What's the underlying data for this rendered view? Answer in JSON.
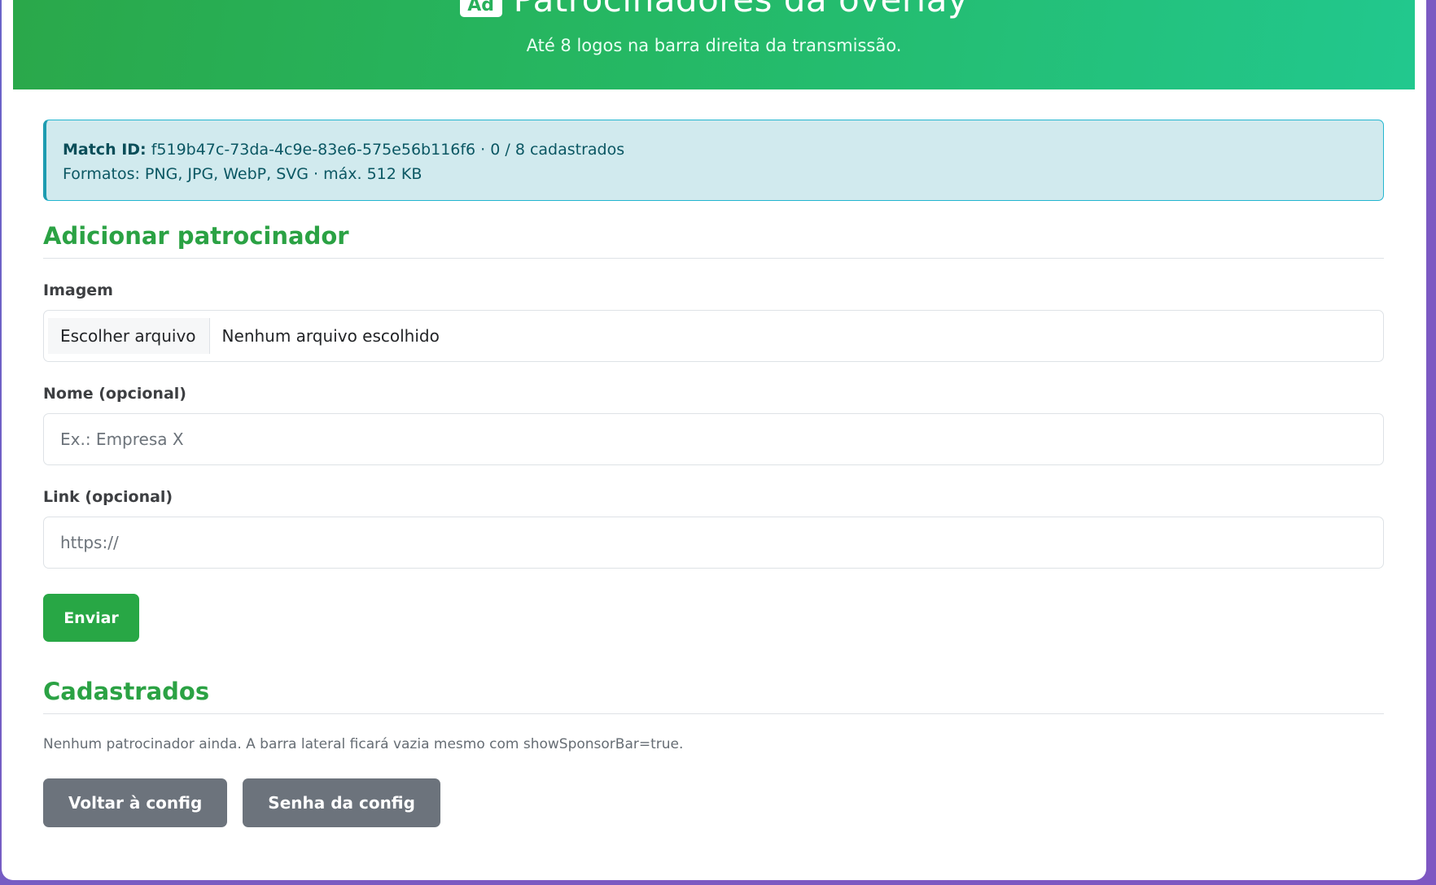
{
  "header": {
    "icon": "ad-icon",
    "icon_text": "Ad",
    "title": "Patrocinadores da overlay",
    "subtitle": "Até 8 logos na barra direita da transmissão."
  },
  "info": {
    "match_label": "Match ID:",
    "match_value": "f519b47c-73da-4c9e-83e6-575e56b116f6 · 0 / 8 cadastrados",
    "formats": "Formatos: PNG, JPG, WebP, SVG · máx. 512 KB"
  },
  "add_section": {
    "title": "Adicionar patrocinador",
    "image_label": "Imagem",
    "file_button": "Escolher arquivo",
    "file_status": "Nenhum arquivo escolhido",
    "name_label": "Nome (opcional)",
    "name_placeholder": "Ex.: Empresa X",
    "name_value": "",
    "link_label": "Link (opcional)",
    "link_placeholder": "https://",
    "link_value": "",
    "submit_label": "Enviar"
  },
  "registered_section": {
    "title": "Cadastrados",
    "empty_text": "Nenhum patrocinador ainda. A barra lateral ficará vazia mesmo com showSponsorBar=true.",
    "back_button": "Voltar à config",
    "password_button": "Senha da config"
  },
  "colors": {
    "header_gradient_start": "#2aa84a",
    "header_gradient_end": "#22c88e",
    "accent_green": "#28a745",
    "info_bg": "#d1eaee",
    "info_border": "#23b6d0",
    "secondary_button": "#6c737c",
    "page_background": "#7a5bc2"
  }
}
